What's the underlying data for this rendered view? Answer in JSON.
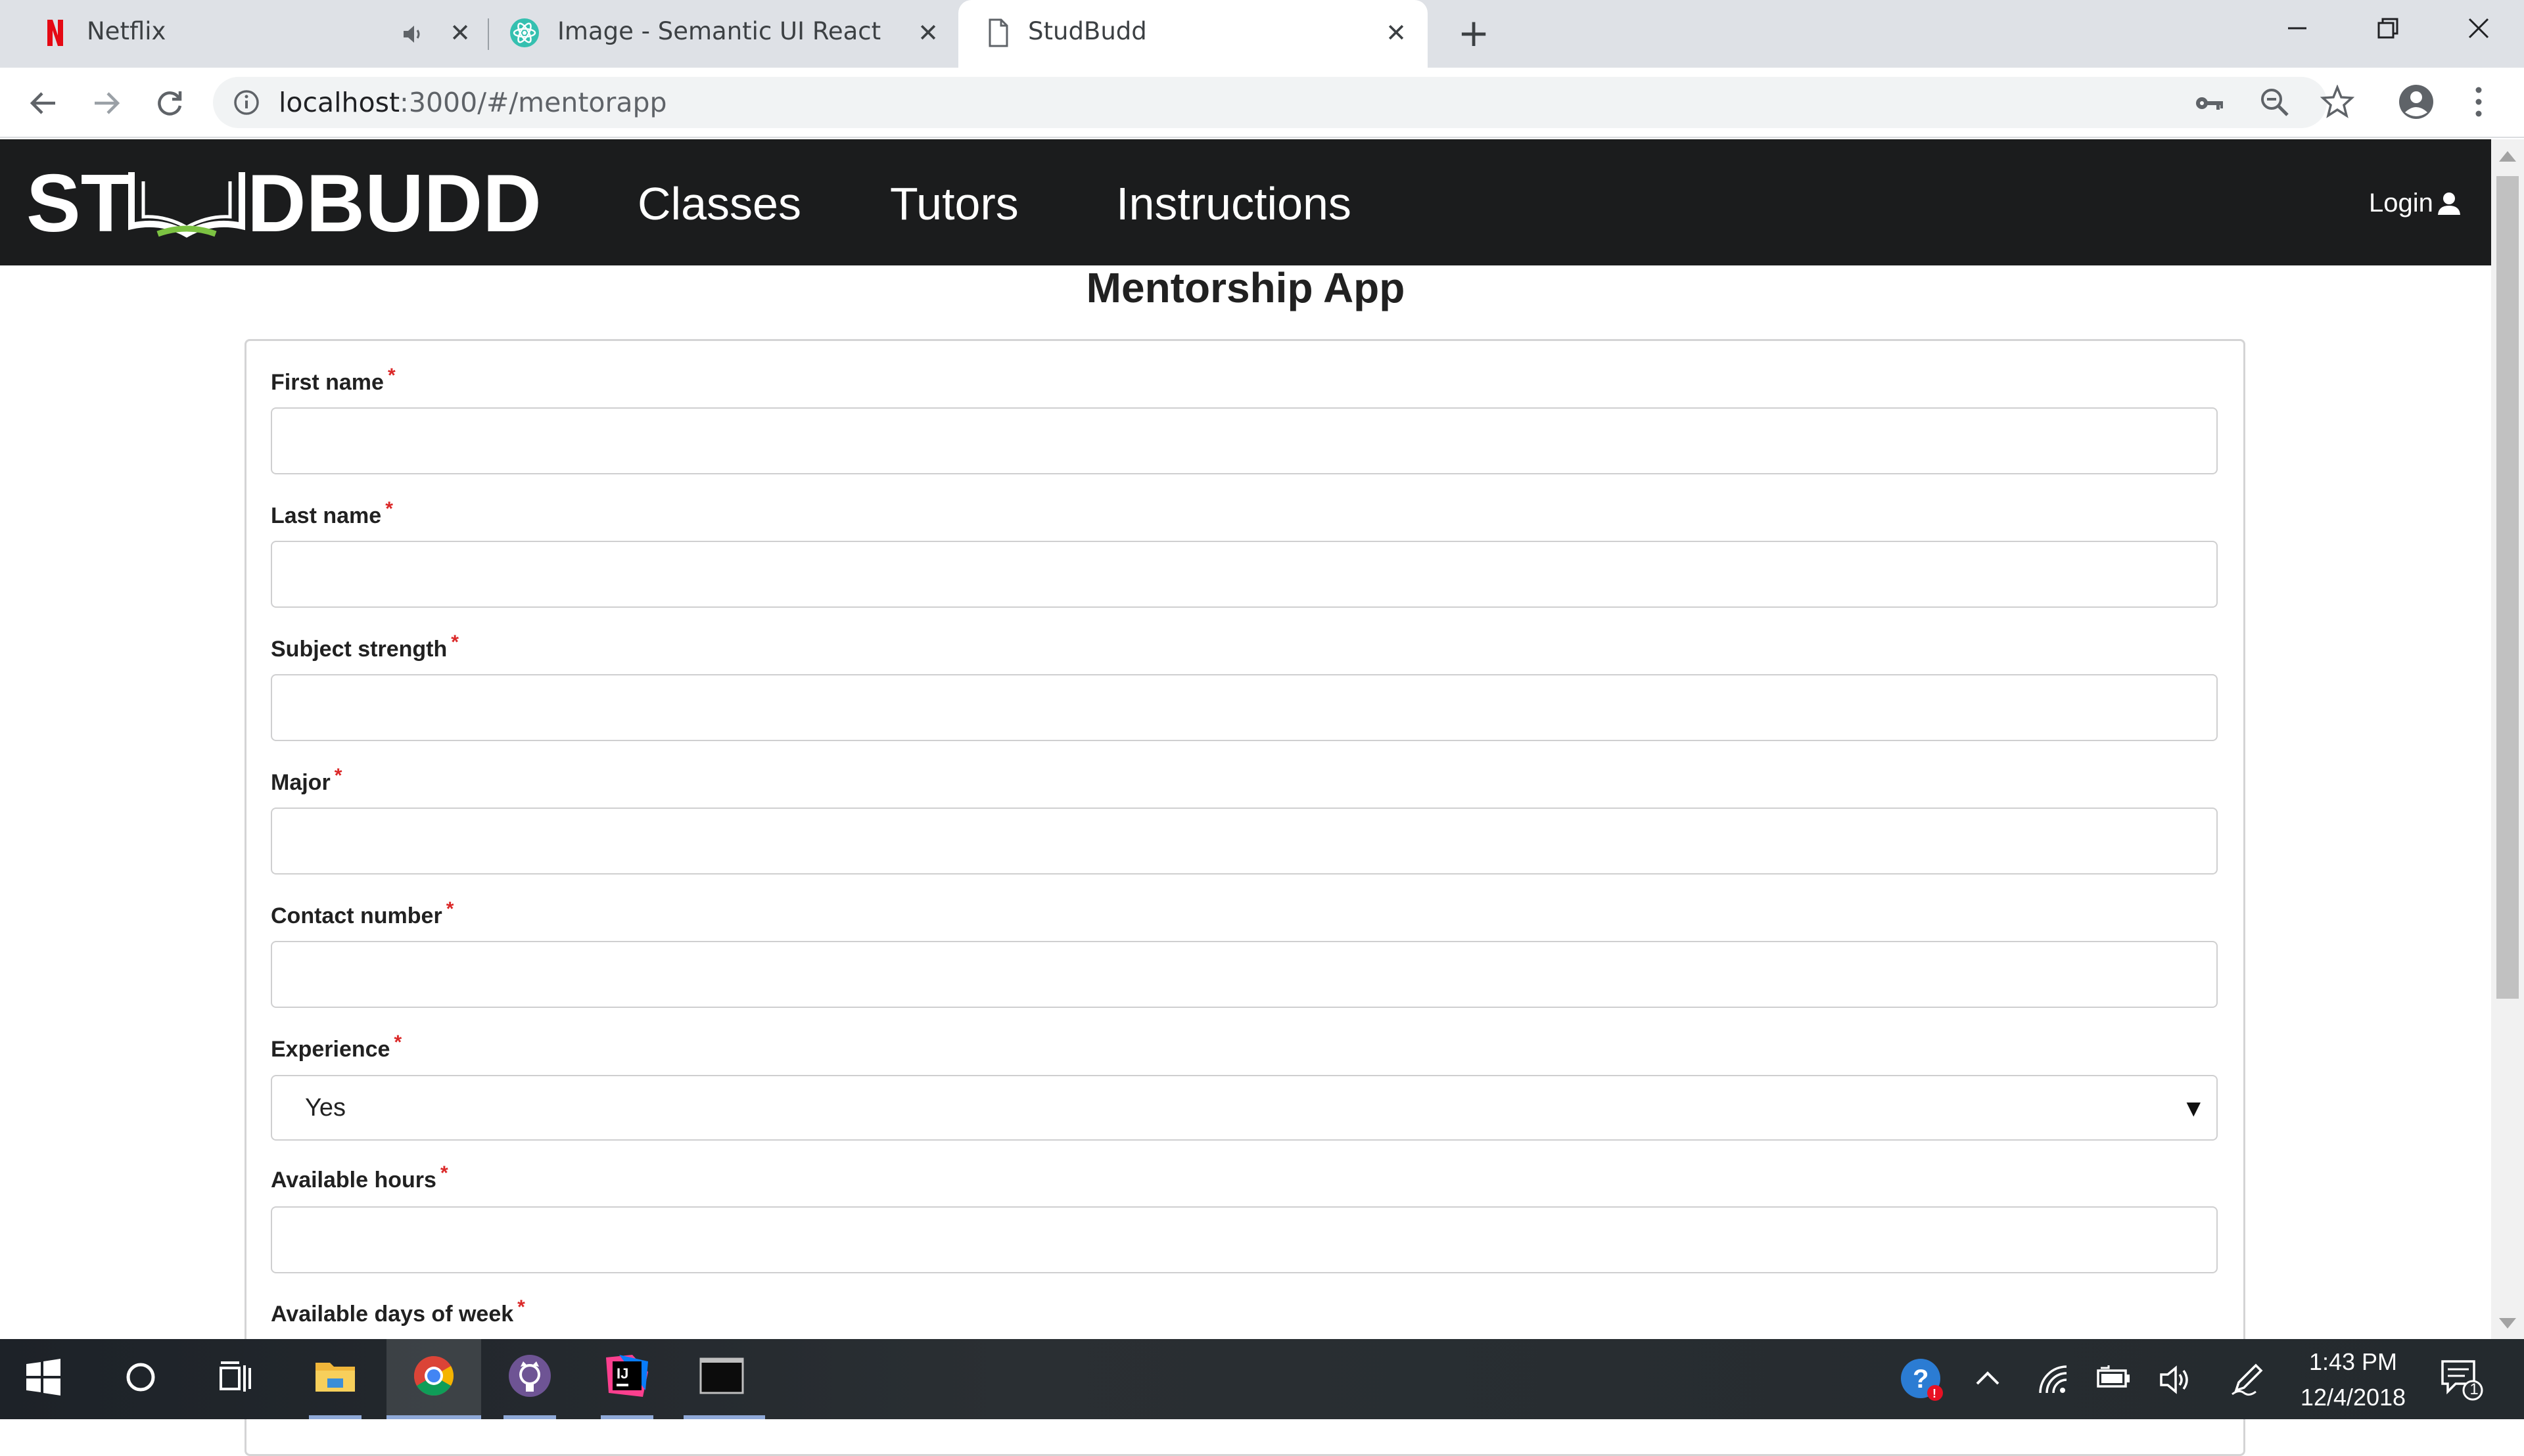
{
  "browser": {
    "tabs": [
      {
        "title": "Netflix",
        "icon": "netflix-icon",
        "audio": "speaker-icon"
      },
      {
        "title": "Image - Semantic UI React",
        "icon": "react-icon"
      },
      {
        "title": "StudBudd",
        "icon": "page-icon",
        "active": true
      }
    ],
    "url_host": "localhost",
    "url_path": ":3000/#/mentorapp"
  },
  "app": {
    "logo_text": "ST  DBUDD",
    "nav": {
      "classes": "Classes",
      "tutors": "Tutors",
      "instructions": "Instructions"
    },
    "login": "Login",
    "accent_color": "#7cc242"
  },
  "page": {
    "title": "Mentorship App",
    "fields": {
      "first_name": "First name",
      "last_name": "Last name",
      "subject_strength": "Subject strength",
      "major": "Major",
      "contact_number": "Contact number",
      "experience": "Experience",
      "available_hours": "Available hours",
      "available_days": "Available days of week"
    },
    "required_marker": "*",
    "experience_value": "Yes"
  },
  "taskbar": {
    "time": "1:43 PM",
    "date": "12/4/2018",
    "notification_count": "1"
  }
}
